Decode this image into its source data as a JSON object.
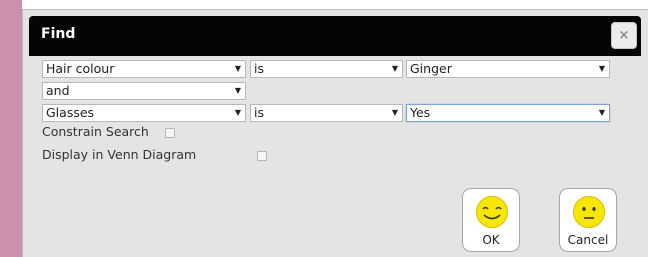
{
  "dialog": {
    "title": "Find",
    "close_label": "×"
  },
  "criteria": {
    "row1": {
      "field": "Hair colour",
      "operator": "is",
      "value": "Ginger"
    },
    "connector": "and",
    "row2": {
      "field": "Glasses",
      "operator": "is",
      "value": "Yes"
    }
  },
  "options": {
    "constrain_label": "Constrain Search",
    "constrain_checked": false,
    "venn_label": "Display in Venn Diagram",
    "venn_checked": false
  },
  "buttons": {
    "ok_label": "OK",
    "cancel_label": "Cancel"
  },
  "dropdown_arrow": "▼",
  "colors": {
    "titlebar": "#050505",
    "dialog_bg": "#e4e4e4",
    "smiley_yellow": "#f7e600"
  }
}
